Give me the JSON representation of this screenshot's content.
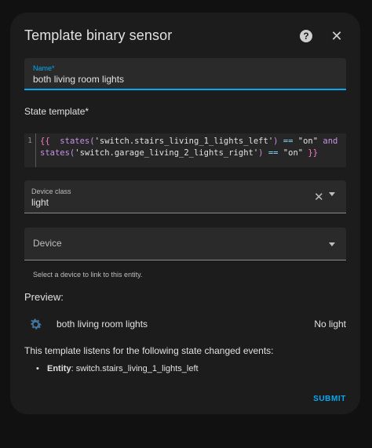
{
  "dialog": {
    "title": "Template binary sensor",
    "help_icon": "help-circle-icon",
    "close_icon": "close-icon"
  },
  "name_field": {
    "label": "Name*",
    "value": "both living room lights"
  },
  "state_template": {
    "label": "State template*",
    "line_number": "1",
    "line1": {
      "open": "{{",
      "fn": "  states(",
      "arg": "'switch.stairs_living_1_lights_left'",
      "close": ")",
      "op": " == ",
      "val": "\"on\"",
      "and": " and"
    },
    "line2": {
      "fn": "states(",
      "arg": "'switch.garage_living_2_lights_right'",
      "close": ")",
      "op": " == ",
      "val": "\"on\"",
      "end": " }}"
    }
  },
  "device_class": {
    "label": "Device class",
    "value": "light"
  },
  "device": {
    "placeholder": "Device",
    "helper": "Select a device to link to this entity."
  },
  "preview": {
    "label": "Preview:",
    "entity_icon": "gear-icon",
    "entity_name": "both living room lights",
    "entity_state": "No light",
    "listens_text": "This template listens for the following state changed events:",
    "events": [
      {
        "type": "Entity",
        "value": "switch.stairs_living_1_lights_left"
      }
    ]
  },
  "actions": {
    "submit_label": "SUBMIT"
  },
  "colors": {
    "accent": "#03a9f4",
    "dialog_bg": "#1c1c1c",
    "field_bg": "#2a2a2a"
  }
}
